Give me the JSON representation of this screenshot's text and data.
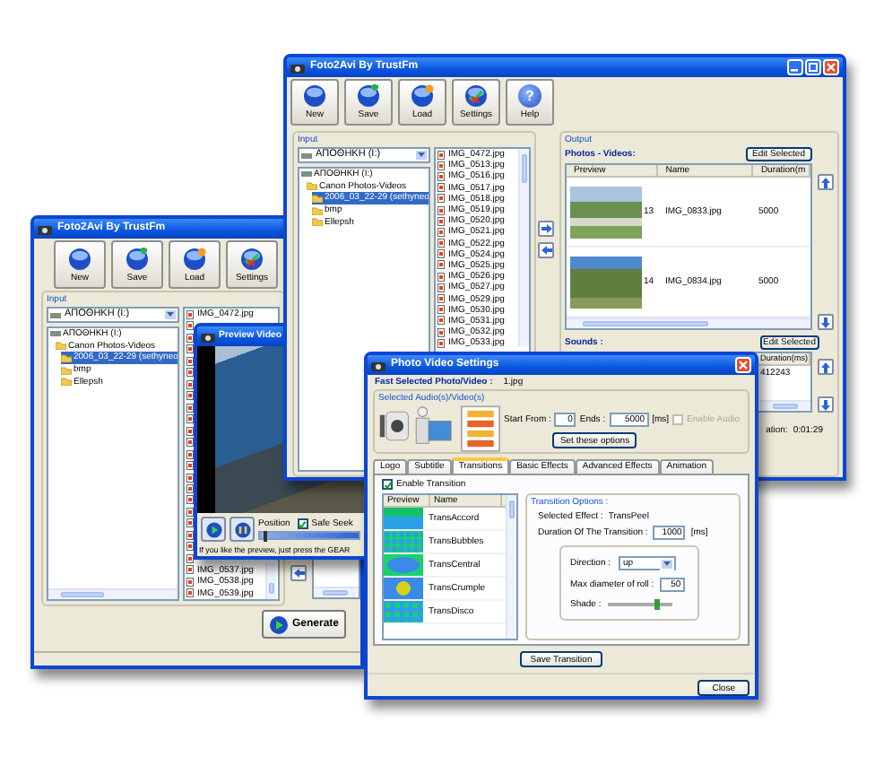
{
  "back_window": {
    "title": "Foto2Avi By TrustFm",
    "toolbar": [
      {
        "label": "New",
        "kind": "new"
      },
      {
        "label": "Save",
        "kind": "save"
      },
      {
        "label": "Load",
        "kind": "load"
      },
      {
        "label": "Settings",
        "kind": "settings"
      }
    ],
    "input_label": "Input",
    "drive": "ΑΠΟΘΗΚΗ (I:)",
    "tree": [
      {
        "label": "ΑΠΟΘΗΚΗ (I:)",
        "kind": "drive",
        "selected": false,
        "children": [
          {
            "label": "Canon Photos-Videos",
            "kind": "folder",
            "selected": false,
            "children": [
              {
                "label": "2006_03_22-29 (sethyneo",
                "kind": "folder",
                "selected": true
              },
              {
                "label": "bmp",
                "kind": "folder",
                "selected": false
              },
              {
                "label": "Ellepsh",
                "kind": "folder",
                "selected": false
              }
            ]
          }
        ]
      }
    ],
    "files_top": [
      "IMG_0472.jpg"
    ],
    "files_bottom": [
      "IMG_0537.jpg",
      "IMG_0538.jpg",
      "IMG_0539.jpg"
    ],
    "generate_button": "Generate"
  },
  "preview_window": {
    "title": "Preview Video",
    "position_label": "Position",
    "safe_seek": {
      "label": "Safe Seek",
      "checked": true
    },
    "position": {
      "level": 0.03
    },
    "hint": "If you like the preview, just press the GEAR"
  },
  "main_window": {
    "title": "Foto2Avi By TrustFm",
    "toolbar": [
      {
        "label": "New",
        "kind": "new"
      },
      {
        "label": "Save",
        "kind": "save"
      },
      {
        "label": "Load",
        "kind": "load"
      },
      {
        "label": "Settings",
        "kind": "settings"
      },
      {
        "label": "Help",
        "kind": "help",
        "glyph": "?"
      }
    ],
    "input_label": "Input",
    "drive": "ΑΠΟΘΗΚΗ (I:)",
    "tree": [
      {
        "label": "ΑΠΟΘΗΚΗ (I:)",
        "kind": "drive",
        "selected": false,
        "children": [
          {
            "label": "Canon Photos-Videos",
            "kind": "folder",
            "selected": false,
            "children": [
              {
                "label": "2006_03_22-29 (sethyneo",
                "kind": "folder",
                "selected": true
              },
              {
                "label": "bmp",
                "kind": "folder",
                "selected": false
              },
              {
                "label": "Ellepsh",
                "kind": "folder",
                "selected": false
              }
            ]
          }
        ]
      }
    ],
    "files": [
      "IMG_0472.jpg",
      "IMG_0513.jpg",
      "IMG_0516.jpg",
      "IMG_0517.jpg",
      "IMG_0518.jpg",
      "IMG_0519.jpg",
      "IMG_0520.jpg",
      "IMG_0521.jpg",
      "IMG_0522.jpg",
      "IMG_0524.jpg",
      "IMG_0525.jpg",
      "IMG_0526.jpg",
      "IMG_0527.jpg",
      "IMG_0529.jpg",
      "IMG_0530.jpg",
      "IMG_0531.jpg",
      "IMG_0532.jpg",
      "IMG_0533.jpg"
    ],
    "output_label": "Output",
    "photos_label": "Photos - Videos:",
    "photos_edit_button": "Edit Selected",
    "photo_columns": [
      "Preview",
      "Name",
      "Duration(m"
    ],
    "photo_rows": [
      {
        "index": "13",
        "name": "IMG_0833.jpg",
        "duration": "5000"
      },
      {
        "index": "14",
        "name": "IMG_0834.jpg",
        "duration": "5000"
      }
    ],
    "sounds_label": "Sounds :",
    "sounds_edit_button": "Edit Selected",
    "sound_columns": [
      "Duration(ms)"
    ],
    "sound_rows": [
      {
        "duration": "412243"
      }
    ],
    "total_label": "ation:",
    "total_value": "0:01:29"
  },
  "settings_window": {
    "title": "Photo Video Settings",
    "fast_label": "Fast Selected Photo/Video :",
    "fast_value": "1.jpg",
    "media_group": "Selected Audio(s)/Video(s)",
    "start_label": "Start From :",
    "start_value": "0",
    "ends_label": "Ends :",
    "ends_value": "5000",
    "ends_unit": "[ms]",
    "enable_audio": {
      "label": "Enable Audio",
      "checked": false,
      "disabled": true
    },
    "set_button": "Set these options",
    "tabs": [
      {
        "label": "Logo",
        "selected": false
      },
      {
        "label": "Subtitle",
        "selected": false
      },
      {
        "label": "Transitions",
        "selected": true
      },
      {
        "label": "Basic Effects",
        "selected": false
      },
      {
        "label": "Advanced Effects",
        "selected": false
      },
      {
        "label": "Animation",
        "selected": false
      }
    ],
    "enable_transition": {
      "label": "Enable Transition",
      "checked": true
    },
    "list_columns": [
      "Preview",
      "Name"
    ],
    "transitions": [
      {
        "name": "TransAccord",
        "kind": "accord"
      },
      {
        "name": "TransBubbles",
        "kind": "bubbles"
      },
      {
        "name": "TransCentral",
        "kind": "central"
      },
      {
        "name": "TransCrumple",
        "kind": "crumple"
      },
      {
        "name": "TransDisco",
        "kind": "disco"
      }
    ],
    "options_label": "Transition Options :",
    "selected_effect_label": "Selected Effect :",
    "selected_effect": "TransPeel",
    "duration_label": "Duration Of The Transition :",
    "duration_value": "1000",
    "duration_unit": "[ms]",
    "direction_label": "Direction :",
    "direction_value": "up",
    "diameter_label": "Max diameter of roll :",
    "diameter_value": "50",
    "shade_label": "Shade :",
    "shade": {
      "level": 0.72
    },
    "save_button": "Save Transition",
    "close_button": "Close"
  }
}
